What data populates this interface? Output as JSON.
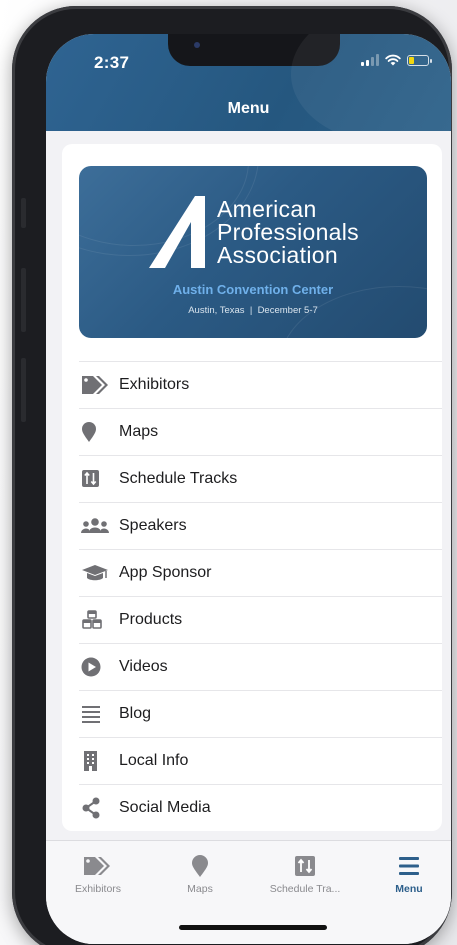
{
  "status_bar": {
    "time": "2:37"
  },
  "header": {
    "title": "Menu"
  },
  "banner": {
    "org_line1": "American",
    "org_line2": "Professionals",
    "org_line3": "Association",
    "venue": "Austin Convention Center",
    "location": "Austin, Texas  |  December 5-7"
  },
  "menu": [
    {
      "label": "Exhibitors",
      "icon": "tag-icon"
    },
    {
      "label": "Maps",
      "icon": "map-pin-icon"
    },
    {
      "label": "Schedule Tracks",
      "icon": "schedule-tracks-icon"
    },
    {
      "label": "Speakers",
      "icon": "users-icon"
    },
    {
      "label": "App Sponsor",
      "icon": "graduation-cap-icon"
    },
    {
      "label": "Products",
      "icon": "cubes-icon"
    },
    {
      "label": "Videos",
      "icon": "play-circle-icon"
    },
    {
      "label": "Blog",
      "icon": "list-icon"
    },
    {
      "label": "Local Info",
      "icon": "building-icon"
    },
    {
      "label": "Social Media",
      "icon": "share-icon"
    }
  ],
  "tabbar": [
    {
      "label": "Exhibitors",
      "icon": "tag-icon",
      "active": false
    },
    {
      "label": "Maps",
      "icon": "map-pin-icon",
      "active": false
    },
    {
      "label": "Schedule Tra...",
      "icon": "schedule-tracks-icon",
      "active": false
    },
    {
      "label": "Menu",
      "icon": "hamburger-menu-icon",
      "active": true
    }
  ],
  "colors": {
    "header": "#2f6492",
    "accent": "#2d5f8b",
    "venue_text": "#6fb0ea",
    "icon_gray": "#707074"
  }
}
